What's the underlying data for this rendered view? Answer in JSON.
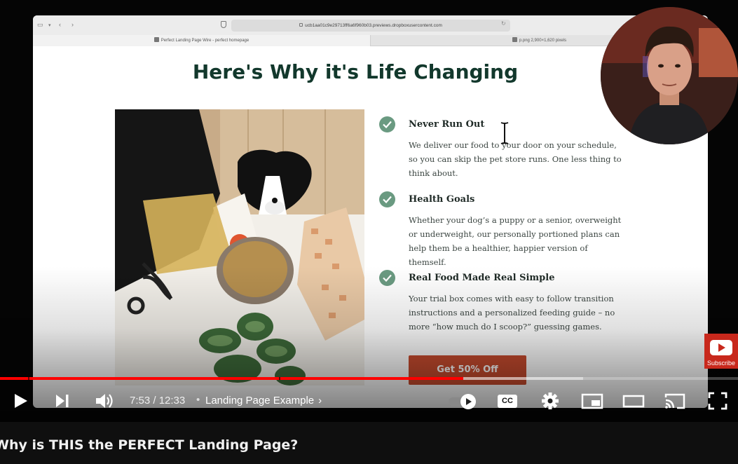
{
  "browser": {
    "url": "ucb1aa01c9e29713ff6a6f960b03.previews.dropboxusercontent.com",
    "tabs": [
      {
        "label": "Perfect Landing Page Wire - perfect homepage"
      },
      {
        "label": "p.png 2,900×1,620 pixels"
      }
    ]
  },
  "landing": {
    "headline": "Here's Why it's Life Changing",
    "features": [
      {
        "title": "Never Run Out",
        "body": "We deliver our food to your door on your schedule, so you can skip the pet store runs. One less thing to think about."
      },
      {
        "title": "Health Goals",
        "body": "Whether your dog’s a puppy or a senior, overweight or underweight, our personally portioned plans can help them be a healthier, happier version of themself."
      },
      {
        "title": "Real Food Made Real Simple",
        "body": "Your trial box comes with easy to follow transition instructions and a personalized feeding guide – no more “how much do I scoop?” guessing games."
      }
    ],
    "cta_label": "Get 50% Off",
    "accent_color": "#6a9a81",
    "cta_color": "#c74b2e"
  },
  "subscribe_label": "Subscribe",
  "player": {
    "current_time": "7:53",
    "duration": "12:33",
    "time_display": "7:53 / 12:33",
    "chapter_label": "Landing Page Example",
    "progress_fraction": 0.628,
    "buffered_fraction": 0.79,
    "chapter_marks": [
      0.038,
      0.378
    ]
  },
  "video": {
    "title": "Why is THIS the PERFECT Landing Page?"
  },
  "icons": [
    "play-icon",
    "next-icon",
    "volume-icon",
    "autoplay-toggle",
    "cc-icon",
    "settings-gear-icon",
    "miniplayer-icon",
    "theater-mode-icon",
    "cast-icon",
    "fullscreen-icon",
    "check-icon",
    "text-cursor-icon",
    "youtube-logo-icon"
  ]
}
